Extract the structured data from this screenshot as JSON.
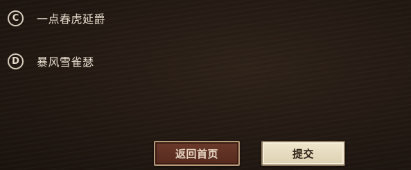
{
  "options": [
    {
      "letter": "C",
      "text": "一点春虎延爵"
    },
    {
      "letter": "D",
      "text": "暴风雪雀瑟"
    }
  ],
  "buttons": {
    "home_label": "返回首页",
    "submit_label": "提交"
  },
  "colors": {
    "background": "#231913",
    "option_text": "#e6dccb",
    "home_button": "#5e3124",
    "submit_button": "#e8dec2"
  }
}
